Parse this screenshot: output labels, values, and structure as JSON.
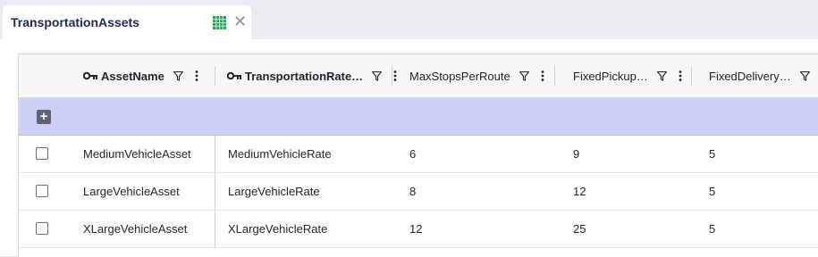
{
  "tab": {
    "title": "TransportationAssets",
    "grid_icon": "table-grid-icon",
    "grid_icon_color": "#2e9e5b",
    "close_icon": "close-icon",
    "close_glyph": "✕"
  },
  "grid": {
    "add_glyph": "+",
    "add_row_color": "#cdd0f5",
    "columns": [
      {
        "label": "AssetName",
        "key": true
      },
      {
        "label": "TransportationRate…",
        "key": true
      },
      {
        "label": "MaxStopsPerRoute",
        "key": false
      },
      {
        "label": "FixedPickup…",
        "key": false
      },
      {
        "label": "FixedDelivery…",
        "key": false
      }
    ],
    "rows": [
      {
        "AssetName": "MediumVehicleAsset",
        "TransportationRate": "MediumVehicleRate",
        "MaxStopsPerRoute": "6",
        "FixedPickup": "9",
        "FixedDelivery": "5"
      },
      {
        "AssetName": "LargeVehicleAsset",
        "TransportationRate": "LargeVehicleRate",
        "MaxStopsPerRoute": "8",
        "FixedPickup": "12",
        "FixedDelivery": "5"
      },
      {
        "AssetName": "XLargeVehicleAsset",
        "TransportationRate": "XLargeVehicleRate",
        "MaxStopsPerRoute": "12",
        "FixedPickup": "25",
        "FixedDelivery": "5"
      }
    ]
  }
}
